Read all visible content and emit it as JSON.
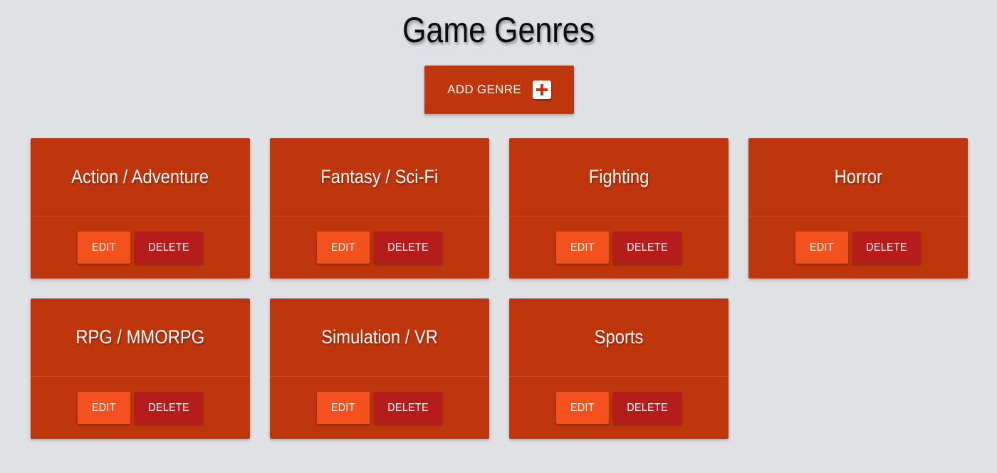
{
  "page": {
    "title": "Game Genres"
  },
  "toolbar": {
    "add_label": "ADD GENRE",
    "add_icon": "plus-square-icon"
  },
  "colors": {
    "background": "#dfe1e4",
    "card": "#bf360c",
    "edit_button": "#f4511e",
    "delete_button": "#b71c1c"
  },
  "genres": [
    {
      "name": "Action / Adventure",
      "edit_label": "EDIT",
      "delete_label": "DELETE"
    },
    {
      "name": "Fantasy / Sci-Fi",
      "edit_label": "EDIT",
      "delete_label": "DELETE"
    },
    {
      "name": "Fighting",
      "edit_label": "EDIT",
      "delete_label": "DELETE"
    },
    {
      "name": "Horror",
      "edit_label": "EDIT",
      "delete_label": "DELETE"
    },
    {
      "name": "RPG / MMORPG",
      "edit_label": "EDIT",
      "delete_label": "DELETE"
    },
    {
      "name": "Simulation / VR",
      "edit_label": "EDIT",
      "delete_label": "DELETE"
    },
    {
      "name": "Sports",
      "edit_label": "EDIT",
      "delete_label": "DELETE"
    }
  ]
}
